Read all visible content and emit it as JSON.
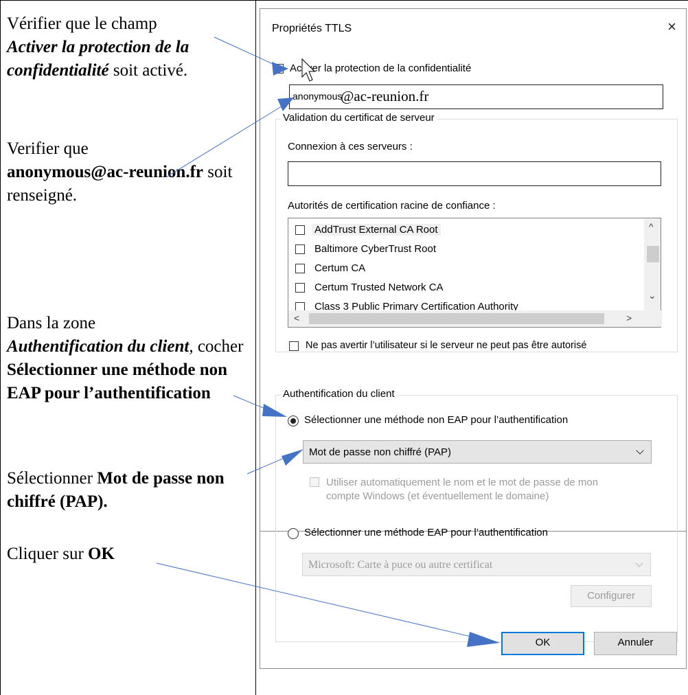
{
  "instructions": {
    "step1": {
      "prefix": "Vérifier que le champ",
      "bold_italic": "Activer la protection de la confidentialité",
      "suffix": "soit activé."
    },
    "step2": {
      "prefix": "Verifier que",
      "bold": "anonymous@ac-reunion.fr",
      "suffix": "soit renseigné."
    },
    "step3": {
      "prefix": "Dans la zone",
      "italic": "Authentification du client",
      "middle": ", cocher",
      "bold": "Sélectionner une méthode non EAP pour l’authentification"
    },
    "step4": {
      "prefix": "Sélectionner",
      "bold": "Mot de passe non chiffré (PAP)."
    },
    "step5": {
      "prefix": "Cliquer sur",
      "bold": "OK"
    }
  },
  "dialog": {
    "title": "Propriétés TTLS",
    "close_glyph": "×",
    "privacy_checkbox_label": "Activer la protection de la confidentialité",
    "privacy_checked": true,
    "identity": {
      "prefix": "anonymous",
      "suffix": "@ac-reunion.fr"
    },
    "server_validation": {
      "group_title": "Validation du certificat de serveur",
      "servers_label": "Connexion à ces serveurs :",
      "servers_value": "",
      "ca_label": "Autorités de certification racine de confiance :",
      "ca_items": [
        "AddTrust External CA Root",
        "Baltimore CyberTrust Root",
        "Certum CA",
        "Certum Trusted Network CA",
        "Class 3 Public Primary Certification Authority"
      ],
      "no_prompt_label": "Ne pas avertir l’utilisateur si le serveur ne peut pas être autorisé"
    },
    "client_auth": {
      "group_title": "Authentification du client",
      "non_eap_radio_label": "Sélectionner une méthode non EAP pour l’authentification",
      "non_eap_selected": true,
      "non_eap_method": "Mot de passe non chiffré (PAP)",
      "auto_windows_label_line1": "Utiliser automatiquement le nom et le mot de passe de mon",
      "auto_windows_label_line2": "compte Windows (et éventuellement le domaine)",
      "eap_radio_label": "Sélectionner une méthode EAP pour l’authentification",
      "eap_method": "Microsoft: Carte à puce ou autre certificat",
      "configure_button": "Configurer"
    },
    "ok_button": "OK",
    "cancel_button": "Annuler"
  },
  "colors": {
    "arrow": "#4472c4",
    "default_button_border": "#0078d7"
  },
  "icons": {
    "scroll_up": "^",
    "scroll_down": "⌄",
    "scroll_left": "<",
    "scroll_right": ">"
  }
}
